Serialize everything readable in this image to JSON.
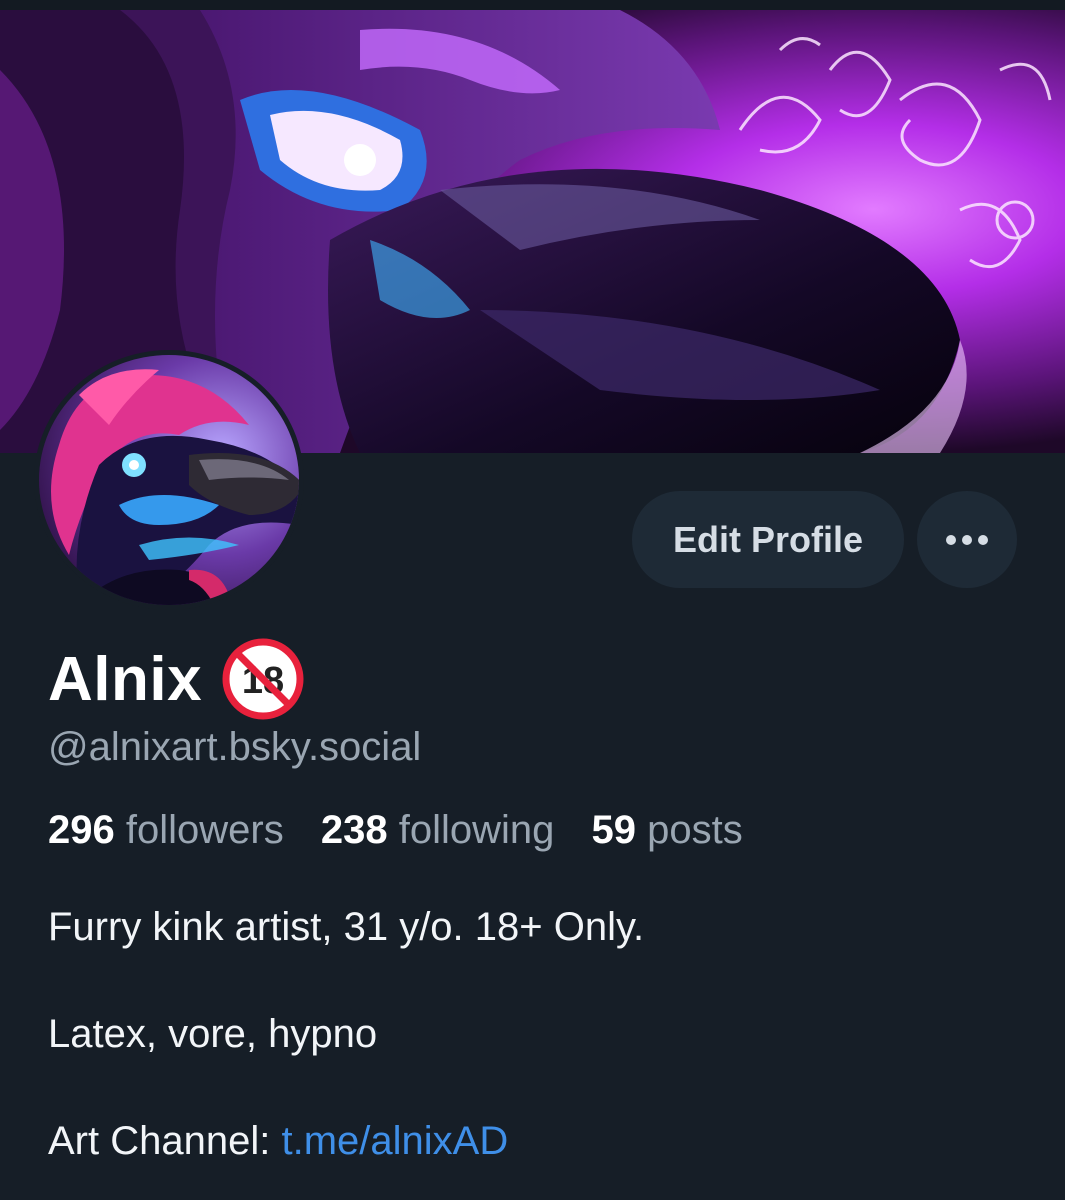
{
  "profile": {
    "display_name": "Alnix",
    "badge_icon": "no-under-18-icon",
    "badge_text": "18",
    "handle": "@alnixart.bsky.social",
    "stats": {
      "followers_count": "296",
      "followers_label": "followers",
      "following_count": "238",
      "following_label": "following",
      "posts_count": "59",
      "posts_label": "posts"
    },
    "bio": {
      "line1": "Furry kink artist, 31 y/o. 18+ Only.",
      "line2": "Latex, vore, hypno",
      "line3_prefix": "Art Channel: ",
      "line3_link": "t.me/alnixAD"
    }
  },
  "actions": {
    "edit_profile_label": "Edit Profile",
    "more_icon": "ellipsis-icon"
  },
  "colors": {
    "background": "#161e27",
    "button_bg": "#1e2a36",
    "link": "#3f8fe8",
    "muted_text": "#9aa6b2",
    "banner_accent": "#b42ee8"
  }
}
